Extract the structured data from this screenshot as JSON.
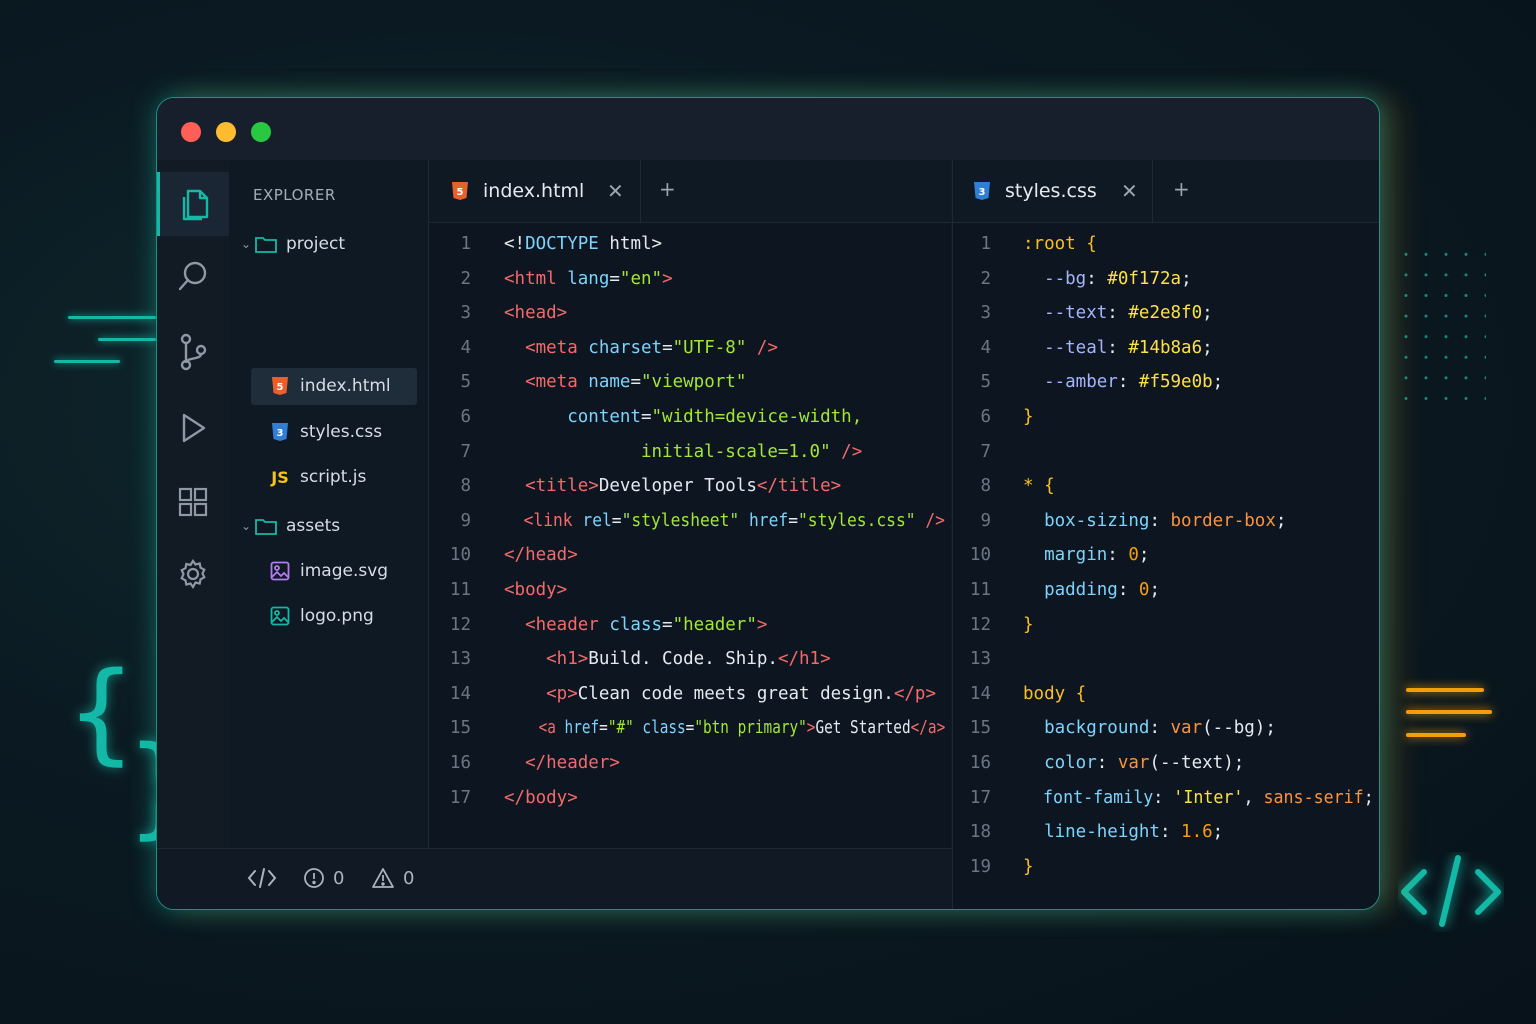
{
  "window": {
    "traffic_lights": [
      "#ff5f57",
      "#febc2e",
      "#28c840"
    ]
  },
  "explorer": {
    "title": "EXPLORER",
    "tree": [
      {
        "label": "project",
        "type": "folder",
        "depth": 0
      },
      {
        "label": "index.html",
        "type": "html",
        "depth": 1,
        "selected": true
      },
      {
        "label": "styles.css",
        "type": "css",
        "depth": 1
      },
      {
        "label": "script.js",
        "type": "js",
        "depth": 1,
        "icon_text": "JS"
      },
      {
        "label": "assets",
        "type": "folder",
        "depth": 0
      },
      {
        "label": "image.svg",
        "type": "image",
        "depth": 1
      },
      {
        "label": "logo.png",
        "type": "image",
        "depth": 1
      }
    ]
  },
  "activity_bar": [
    "files-icon",
    "search-icon",
    "source-control-icon",
    "run-icon",
    "extensions-icon",
    "settings-icon",
    "account-icon"
  ],
  "editor_left": {
    "tab_label": "index.html",
    "lines": [
      [
        [
          "<!",
          "p"
        ],
        [
          "DOCTYPE",
          "kw"
        ],
        [
          " html>",
          "p"
        ]
      ],
      [
        [
          "<html ",
          "t"
        ],
        [
          "lang",
          "a"
        ],
        [
          "=",
          "p"
        ],
        [
          "\"en\"",
          "s"
        ],
        [
          ">",
          "t"
        ]
      ],
      [
        [
          "<head>",
          "t"
        ]
      ],
      [
        [
          "  <meta ",
          "t"
        ],
        [
          "charset",
          "a"
        ],
        [
          "=",
          "p"
        ],
        [
          "\"UTF-8\"",
          "s"
        ],
        [
          " />",
          "t"
        ]
      ],
      [
        [
          "  <meta ",
          "t"
        ],
        [
          "name",
          "a"
        ],
        [
          "=",
          "p"
        ],
        [
          "\"viewport\"",
          "s"
        ]
      ],
      [
        [
          "      content",
          "a"
        ],
        [
          "=",
          "p"
        ],
        [
          "\"width=device-width,",
          "s"
        ]
      ],
      [
        [
          "             initial-scale=1.0\"",
          "s"
        ],
        [
          " />",
          "t"
        ]
      ],
      [
        [
          "  <title>",
          "t"
        ],
        [
          "Developer Tools",
          "p"
        ],
        [
          "</title>",
          "t"
        ]
      ],
      [
        [
          "  <link ",
          "t"
        ],
        [
          "rel",
          "a"
        ],
        [
          "=",
          "p"
        ],
        [
          "\"stylesheet\"",
          "s"
        ],
        [
          " href",
          "a"
        ],
        [
          "=",
          "p"
        ],
        [
          "\"styles.css\"",
          "s"
        ],
        [
          " />",
          "t"
        ]
      ],
      [
        [
          "</head>",
          "t"
        ]
      ],
      [
        [
          "<body>",
          "t"
        ]
      ],
      [
        [
          "  <header ",
          "t"
        ],
        [
          "class",
          "a"
        ],
        [
          "=",
          "p"
        ],
        [
          "\"header\"",
          "s"
        ],
        [
          ">",
          "t"
        ]
      ],
      [
        [
          "    <h1>",
          "t"
        ],
        [
          "Build. Code. Ship.",
          "p"
        ],
        [
          "</h1>",
          "t"
        ]
      ],
      [
        [
          "    <p>",
          "t"
        ],
        [
          "Clean code meets great design.",
          "p"
        ],
        [
          "</p>",
          "t"
        ]
      ],
      [
        [
          "    <a ",
          "t"
        ],
        [
          "href",
          "a"
        ],
        [
          "=",
          "p"
        ],
        [
          "\"#\"",
          "s"
        ],
        [
          " class",
          "a"
        ],
        [
          "=",
          "p"
        ],
        [
          "\"btn primary\"",
          "s"
        ],
        [
          ">",
          "t"
        ],
        [
          "Get Started",
          "p"
        ],
        [
          "</a>",
          "t"
        ]
      ],
      [
        [
          "  </header>",
          "t"
        ]
      ],
      [
        [
          "</body>",
          "t"
        ]
      ]
    ]
  },
  "editor_right": {
    "tab_label": "styles.css",
    "lines": [
      [
        [
          ":root {",
          "sel"
        ]
      ],
      [
        [
          "  --bg",
          "var"
        ],
        [
          ": ",
          "p"
        ],
        [
          "#0f172a",
          "hex"
        ],
        [
          ";",
          "p"
        ]
      ],
      [
        [
          "  --text",
          "var"
        ],
        [
          ": ",
          "p"
        ],
        [
          "#e2e8f0",
          "hex"
        ],
        [
          ";",
          "p"
        ]
      ],
      [
        [
          "  --teal",
          "var"
        ],
        [
          ": ",
          "p"
        ],
        [
          "#14b8a6",
          "hex"
        ],
        [
          ";",
          "p"
        ]
      ],
      [
        [
          "  --amber",
          "var"
        ],
        [
          ": ",
          "p"
        ],
        [
          "#f59e0b",
          "hex"
        ],
        [
          ";",
          "p"
        ]
      ],
      [
        [
          "}",
          "sel"
        ]
      ],
      [],
      [
        [
          "* {",
          "sel"
        ]
      ],
      [
        [
          "  box-sizing",
          "prop"
        ],
        [
          ": ",
          "p"
        ],
        [
          "border-box",
          "val"
        ],
        [
          ";",
          "p"
        ]
      ],
      [
        [
          "  margin",
          "prop"
        ],
        [
          ": ",
          "p"
        ],
        [
          "0",
          "num"
        ],
        [
          ";",
          "p"
        ]
      ],
      [
        [
          "  padding",
          "prop"
        ],
        [
          ": ",
          "p"
        ],
        [
          "0",
          "num"
        ],
        [
          ";",
          "p"
        ]
      ],
      [
        [
          "}",
          "sel"
        ]
      ],
      [],
      [
        [
          "body {",
          "sel"
        ]
      ],
      [
        [
          "  background",
          "prop"
        ],
        [
          ": ",
          "p"
        ],
        [
          "var",
          "val"
        ],
        [
          "(--bg);",
          "p"
        ]
      ],
      [
        [
          "  color",
          "prop"
        ],
        [
          ": ",
          "p"
        ],
        [
          "var",
          "val"
        ],
        [
          "(--text);",
          "p"
        ]
      ],
      [
        [
          "  font-family",
          "prop"
        ],
        [
          ": ",
          "p"
        ],
        [
          "'Inter'",
          "hex"
        ],
        [
          ", ",
          "p"
        ],
        [
          "sans-serif",
          "val"
        ],
        [
          ";",
          "p"
        ]
      ],
      [
        [
          "  line-height",
          "prop"
        ],
        [
          ": ",
          "p"
        ],
        [
          "1.6",
          "num"
        ],
        [
          ";",
          "p"
        ]
      ],
      [
        [
          "}",
          "sel"
        ]
      ]
    ]
  },
  "status_bar": {
    "errors": "0",
    "warnings": "0"
  }
}
